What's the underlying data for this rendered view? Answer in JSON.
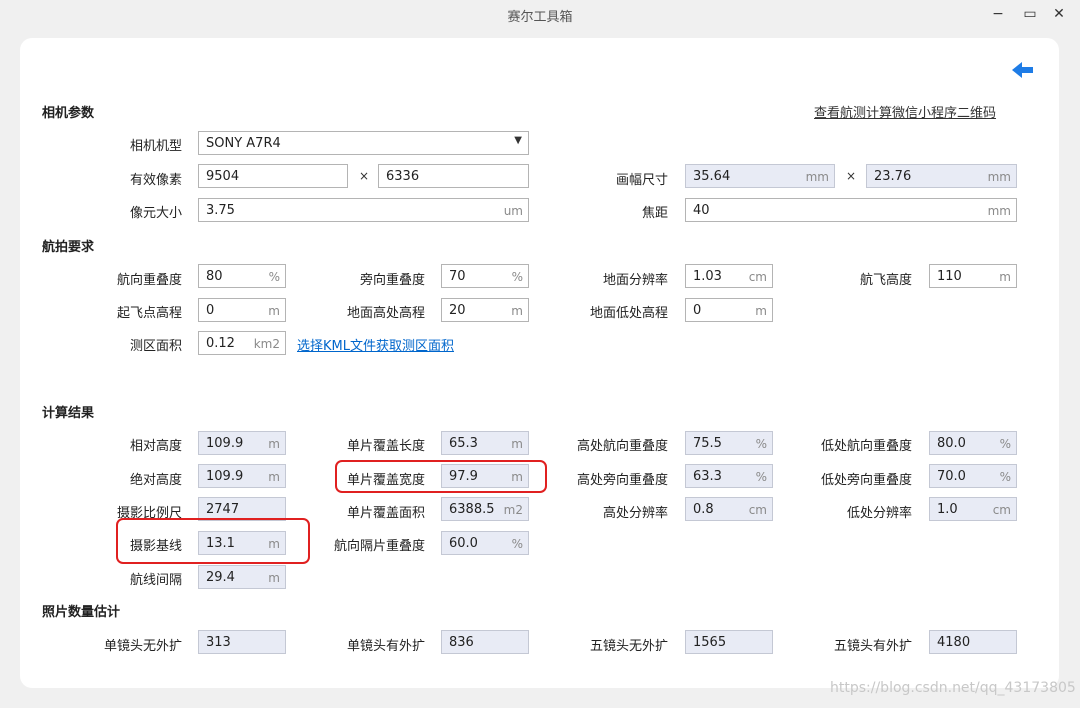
{
  "window": {
    "title": "赛尔工具箱",
    "minimize": "−",
    "maximize": "▭",
    "close": "✕"
  },
  "links": {
    "qr": "查看航测计算微信小程序二维码",
    "kml": "选择KML文件获取测区面积"
  },
  "camera": {
    "section": "相机参数",
    "model_label": "相机机型",
    "model_value": "SONY A7R4",
    "pixels_label": "有效像素",
    "pixels_w": "9504",
    "pixels_h": "6336",
    "times": "×",
    "frame_label": "画幅尺寸",
    "frame_w": "35.64",
    "frame_h": "23.76",
    "frame_unit": "mm",
    "pixel_size_label": "像元大小",
    "pixel_size": "3.75",
    "pixel_size_unit": "um",
    "focal_label": "焦距",
    "focal": "40",
    "focal_unit": "mm"
  },
  "requirements": {
    "section": "航拍要求",
    "forward_overlap_label": "航向重叠度",
    "forward_overlap": "80",
    "pct": "%",
    "side_overlap_label": "旁向重叠度",
    "side_overlap": "70",
    "gsd_label": "地面分辨率",
    "gsd": "1.03",
    "gsd_unit": "cm",
    "flight_height_label": "航飞高度",
    "flight_height": "110",
    "m": "m",
    "takeoff_label": "起飞点高程",
    "takeoff": "0",
    "ground_high_label": "地面高处高程",
    "ground_high": "20",
    "ground_low_label": "地面低处高程",
    "ground_low": "0",
    "area_label": "测区面积",
    "area": "0.12",
    "area_unit": "km2"
  },
  "results": {
    "section": "计算结果",
    "rel_height_label": "相对高度",
    "rel_height": "109.9",
    "abs_height_label": "绝对高度",
    "abs_height": "109.9",
    "scale_label": "摄影比例尺",
    "scale": "2747",
    "baseline_label": "摄影基线",
    "baseline": "13.1",
    "line_spacing_label": "航线间隔",
    "line_spacing": "29.4",
    "cover_len_label": "单片覆盖长度",
    "cover_len": "65.3",
    "cover_wid_label": "单片覆盖宽度",
    "cover_wid": "97.9",
    "cover_area_label": "单片覆盖面积",
    "cover_area": "6388.5",
    "m2": "m2",
    "alt_overlap_label": "航向隔片重叠度",
    "alt_overlap": "60.0",
    "high_fwd_label": "高处航向重叠度",
    "high_fwd": "75.5",
    "high_side_label": "高处旁向重叠度",
    "high_side": "63.3",
    "high_res_label": "高处分辨率",
    "high_res": "0.8",
    "cm": "cm",
    "low_fwd_label": "低处航向重叠度",
    "low_fwd": "80.0",
    "low_side_label": "低处旁向重叠度",
    "low_side": "70.0",
    "low_res_label": "低处分辨率",
    "low_res": "1.0"
  },
  "photos": {
    "section": "照片数量估计",
    "single_noext_label": "单镜头无外扩",
    "single_noext": "313",
    "single_ext_label": "单镜头有外扩",
    "single_ext": "836",
    "five_noext_label": "五镜头无外扩",
    "five_noext": "1565",
    "five_ext_label": "五镜头有外扩",
    "five_ext": "4180"
  },
  "watermark": "https://blog.csdn.net/qq_43173805",
  "colors": {
    "accent": "#1e7ce6",
    "highlight": "#e02020",
    "readonly_bg": "#e8ebf5"
  }
}
